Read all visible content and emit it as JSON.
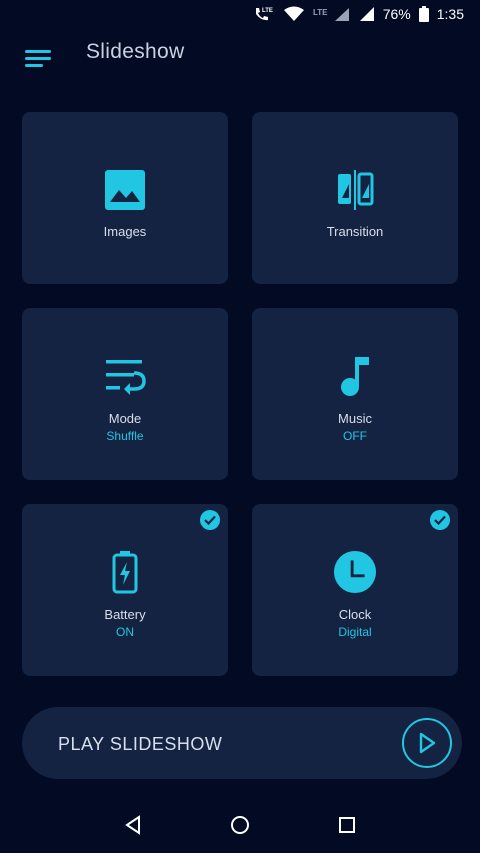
{
  "statusbar": {
    "battery": "76%",
    "time": "1:35",
    "lte_label": "LTE"
  },
  "appbar": {
    "title": "Slideshow"
  },
  "tiles": [
    {
      "label": "Images",
      "value": ""
    },
    {
      "label": "Transition",
      "value": ""
    },
    {
      "label": "Mode",
      "value": "Shuffle"
    },
    {
      "label": "Music",
      "value": "OFF"
    },
    {
      "label": "Battery",
      "value": "ON",
      "checked": true
    },
    {
      "label": "Clock",
      "value": "Digital",
      "checked": true
    }
  ],
  "play": {
    "label": "PLAY SLIDESHOW"
  },
  "colors": {
    "accent": "#21c6e3",
    "background": "#020a24",
    "tile": "#142341"
  },
  "icons": {
    "menu": "menu-icon",
    "images": "image-icon",
    "transition": "transition-icon",
    "mode": "wrap-text-icon",
    "music": "music-note-icon",
    "battery": "battery-charging-icon",
    "clock": "clock-icon",
    "check": "check-icon",
    "play": "play-icon",
    "back": "back-icon",
    "home": "home-icon",
    "recents": "recents-icon"
  }
}
